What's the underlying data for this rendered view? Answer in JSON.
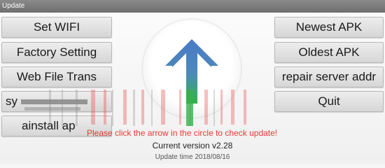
{
  "window": {
    "title": "Update"
  },
  "left_buttons": [
    {
      "label": "Set WIFI"
    },
    {
      "label": "Factory Setting"
    },
    {
      "label": "Web File Trans"
    },
    {
      "label": "sy"
    },
    {
      "label": "ainstall ap"
    }
  ],
  "right_buttons": [
    {
      "label": "Newest APK"
    },
    {
      "label": "Oldest APK"
    },
    {
      "label": "repair server addr"
    },
    {
      "label": "Quit"
    }
  ],
  "center": {
    "hint": "Please click the arrow in the circle to check update!",
    "current_version": "Current version  v2.28",
    "update_time": "Update time  2018/08/16"
  },
  "colors": {
    "arrow_top": "#4a79c7",
    "arrow_bottom": "#33b24a",
    "hint_text": "#e53935"
  },
  "icons": {
    "update": "up-arrow-icon"
  }
}
